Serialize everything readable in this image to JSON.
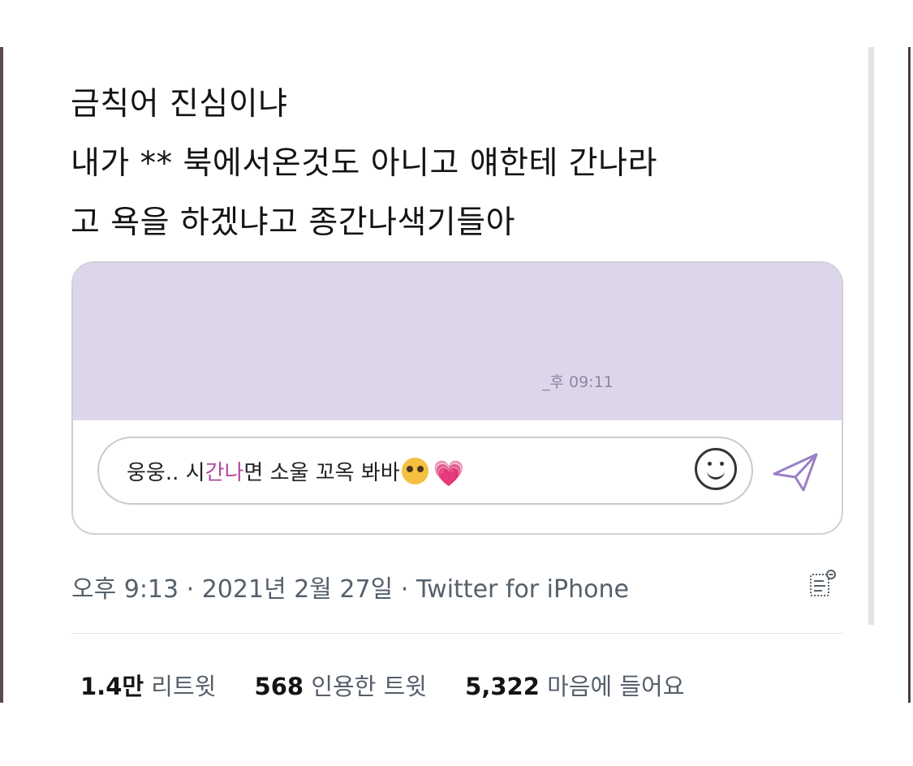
{
  "tweet": {
    "lines": [
      "금칙어 진심이냐",
      "내가 ** 북에서온것도 아니고 얘한테 간나라",
      "고 욕을 하겠냐고 종간나색기들아"
    ]
  },
  "chat_screenshot": {
    "message_time": "_후 09:11",
    "input": {
      "text_before": "웅웅.. 시",
      "text_highlight": "간나",
      "text_after": "면 소울 꼬옥 봐바",
      "emoji_heart": "💗"
    },
    "colors": {
      "message_area_bg": "#ddd6eb",
      "highlight": "#b04aa0",
      "send_icon": "#9b7fc6"
    }
  },
  "meta": {
    "time": "오후 9:13",
    "separator": " · ",
    "date": "2021년 2월 27일",
    "source": "Twitter for iPhone"
  },
  "stats": {
    "retweets_count": "1.4만",
    "retweets_label": "리트윗",
    "quotes_count": "568",
    "quotes_label": "인용한 트윗",
    "likes_count": "5,322",
    "likes_label": "마음에 들어요"
  },
  "icons": {
    "emoji_button": "smiley-face-icon",
    "send_button": "paper-plane-send-icon",
    "tweet_analytics": "tweet-analytics-icon"
  }
}
